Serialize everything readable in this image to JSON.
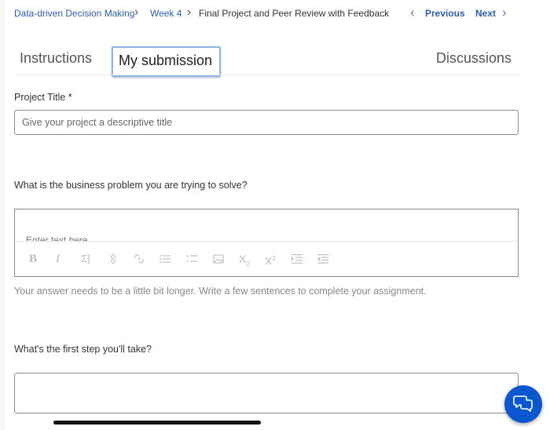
{
  "breadcrumb": {
    "course": "Data-driven Decision Making",
    "week": "Week 4",
    "current": "Final Project and Peer Review with Feedback"
  },
  "nav": {
    "previous_label": "Previous",
    "next_label": "Next"
  },
  "tabs": [
    {
      "label": "Instructions",
      "active": false
    },
    {
      "label": "My submission",
      "active": true
    },
    {
      "label": "Discussions",
      "active": false
    }
  ],
  "form": {
    "project_title": {
      "label": "Project Title *",
      "value": "",
      "placeholder": "Give your project a descriptive title"
    },
    "business_problem": {
      "label": "What is the business problem you are trying to solve?",
      "placeholder": "Enter text here",
      "hint": "Your answer needs to be a little bit longer. Write a few sentences to complete your assignment.",
      "toolbar": [
        "bold-icon",
        "italic-icon",
        "math-icon",
        "link-icon",
        "unlink-icon",
        "bulleted-list-icon",
        "numbered-list-icon",
        "image-icon",
        "subscript-icon",
        "superscript-icon",
        "indent-icon",
        "outdent-icon"
      ]
    },
    "first_step": {
      "label": "What's the first step you'll take?",
      "value": ""
    }
  },
  "colors": {
    "link": "#2a5fb5",
    "fab": "#0b57d0",
    "active_tab_border": "#8fb6e6"
  }
}
